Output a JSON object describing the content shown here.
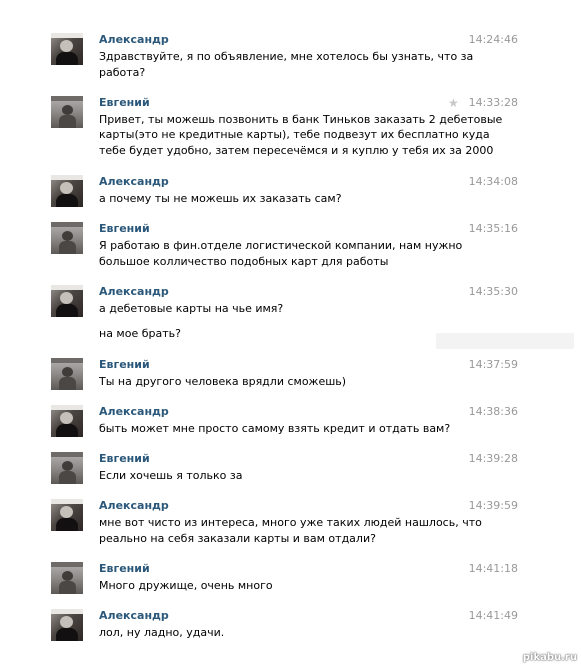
{
  "messages": [
    {
      "author": "Александр",
      "time": "14:24:46",
      "lines": [
        "Здравствуйте, я по объявление, мне хотелось бы узнать, что за",
        "работа?"
      ]
    },
    {
      "author": "Евгений",
      "time": "14:33:28",
      "lines": [
        "Привет, ты можешь позвонить в банк Тиньков заказать 2 дебетовые",
        "карты(это не кредитные карты), тебе подвезут их бесплатно куда",
        "тебе будет удобно, затем пересечёмся и я куплю у тебя их за 2000"
      ]
    },
    {
      "author": "Александр",
      "time": "14:34:08",
      "lines": [
        "а почему ты не можешь их заказать сам?"
      ]
    },
    {
      "author": "Евгений",
      "time": "14:35:16",
      "lines": [
        "Я работаю в фин.отделе логистической компании, нам нужно",
        "большое колличество подобных карт для работы"
      ]
    },
    {
      "author": "Александр",
      "time": "14:35:30",
      "lines": [
        "а дебетовые карты на чье имя?",
        "на мое брать?"
      ]
    },
    {
      "author": "Евгений",
      "time": "14:37:59",
      "lines": [
        "Ты на другого человека врядли сможешь)"
      ]
    },
    {
      "author": "Александр",
      "time": "14:38:36",
      "lines": [
        "быть может мне просто самому взять кредит и отдать вам?"
      ]
    },
    {
      "author": "Евгений",
      "time": "14:39:28",
      "lines": [
        "Если хочешь я только за"
      ]
    },
    {
      "author": "Александр",
      "time": "14:39:59",
      "lines": [
        "мне вот чисто из интереса, много уже таких людей нашлось, что",
        "реально на себя заказали карты и вам отдали?"
      ]
    },
    {
      "author": "Евгений",
      "time": "14:41:18",
      "lines": [
        "Много дружище, очень много"
      ]
    },
    {
      "author": "Александр",
      "time": "14:41:49",
      "lines": [
        "лол, ну ладно, удачи."
      ]
    }
  ],
  "icons": {
    "star": "star-icon"
  },
  "colors": {
    "author": "#2b587a",
    "time": "#999999",
    "text": "#000000"
  },
  "watermark": "pikabu.ru"
}
